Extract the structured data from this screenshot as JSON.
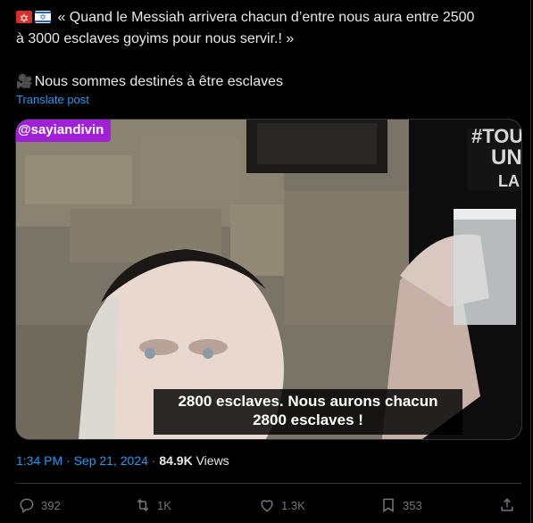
{
  "tweet": {
    "line1": "« Quand le Messiah arrivera chacun d’entre nous aura entre 2500",
    "line2": "à 3000 esclaves goyims pour nous servir.! »",
    "line3": "Nous sommes destinés à être esclaves",
    "translate_label": "Translate post"
  },
  "media": {
    "handle_tag": "@sayiandivin",
    "subtitle_line1": "2800 esclaves. Nous aurons chacun",
    "subtitle_line2": "2800 esclaves !",
    "tag_color": "#a11fd6"
  },
  "meta": {
    "time": "1:34 PM",
    "separator": "·",
    "date": "Sep 21, 2024",
    "separator2": "·",
    "views_count": "84.9K",
    "views_label": "Views"
  },
  "actions": {
    "reply_count": "392",
    "retweet_count": "1K",
    "like_count": "1.3K",
    "bookmark_count": "353"
  },
  "icons": [
    "jewish-star-flag-icon",
    "israel-flag-icon",
    "video-camera-icon",
    "reply-icon",
    "retweet-icon",
    "like-icon",
    "bookmark-icon",
    "share-icon"
  ],
  "colors": {
    "background": "#000000",
    "text": "#e7e9ea",
    "muted": "#71767b",
    "link": "#1d9bf0",
    "divider": "#2f3336"
  }
}
